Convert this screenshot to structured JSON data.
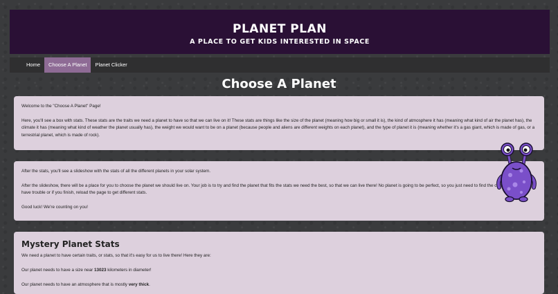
{
  "header": {
    "title": "PLANET PLAN",
    "subtitle": "A PLACE TO GET KIDS INTERESTED IN SPACE"
  },
  "nav": {
    "items": [
      {
        "label": "Home"
      },
      {
        "label": "Choose A Planet"
      },
      {
        "label": "Planet Clicker"
      }
    ],
    "active_index": 1
  },
  "page": {
    "heading": "Choose A Planet"
  },
  "intro": {
    "welcome": "Welcome to the \"Choose A Planet\" Page!",
    "stats_explanation": "Here, you'll see a box with stats. These stats are the traits we need a planet to have so that we can live on it! These stats are things like the size of the planet (meaning how big or small it is), the kind of atmosphere it has (meaning what kind of air the planet has), the climate it has (meaning what kind of weather the planet usually has), the weight we would want to be on a planet (because people and aliens are different weights on each planet), and the type of planet it is (meaning whether it's a gas giant, which is made of gas, or a terrestrial planet, which is made of rock)."
  },
  "instructions": {
    "slideshow": "After the stats, you'll see a slideshow with the stats of all the different planets in your solar system.",
    "task": "After the slideshow, there will be a place for you to choose the planet we should live on. Your job is to try and find the planet that fits the stats we need the best, so that we can live there! No planet is going to be perfect, so you just need to find the closest one. If you have trouble or if you finish, reload the page to get different stats.",
    "good_luck": "Good luck! We're counting on you!"
  },
  "mystery": {
    "heading": "Mystery Planet Stats",
    "intro": "We need a planet to have certain traits, or stats, so that it's easy for us to live there! Here they are:",
    "size_before": "Our planet needs to have a size near ",
    "size_value": "13023",
    "size_after": " kilometers in diameter!",
    "atmosphere_before": "Our planet needs to have an atmosphere that is mostly ",
    "atmosphere_value": "very thick",
    "atmosphere_after": "."
  },
  "colors": {
    "banner": "#2a1035",
    "nav": "#2f2f30",
    "nav_active": "#8e6b95",
    "card": "#ddd0dd",
    "alien": "#7a4fc9"
  },
  "icons": {
    "mascot": "purple-alien-mascot"
  }
}
